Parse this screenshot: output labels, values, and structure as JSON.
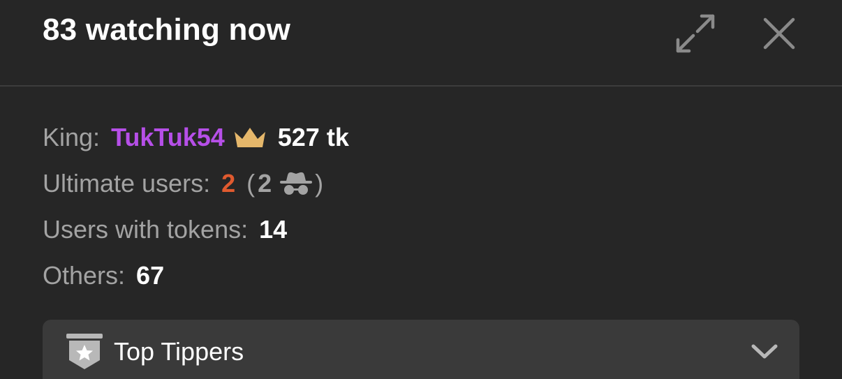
{
  "header": {
    "title": "83 watching now",
    "expand_icon": "expand-arrows-icon",
    "close_icon": "close-x-icon"
  },
  "stats": {
    "king": {
      "label": "King:",
      "name": "TukTuk54",
      "crown_icon": "crown-icon",
      "tokens": "527 tk"
    },
    "ultimate_users": {
      "label": "Ultimate users:",
      "count": "2",
      "open_paren": "(",
      "anonymous_count": "2",
      "anonymous_icon": "incognito-icon",
      "close_paren": ")"
    },
    "users_with_tokens": {
      "label": "Users with tokens:",
      "count": "14"
    },
    "others": {
      "label": "Others:",
      "count": "67"
    }
  },
  "top_tippers": {
    "label": "Top Tippers",
    "badge_icon": "star-badge-icon",
    "chevron_icon": "chevron-down-icon"
  },
  "colors": {
    "background": "#262626",
    "king_name": "#b64fe8",
    "ultimate_count": "#e05a2f",
    "crown": "#e5b76b",
    "label": "#a3a3a3",
    "tippers_bar": "#3a3a3a"
  }
}
